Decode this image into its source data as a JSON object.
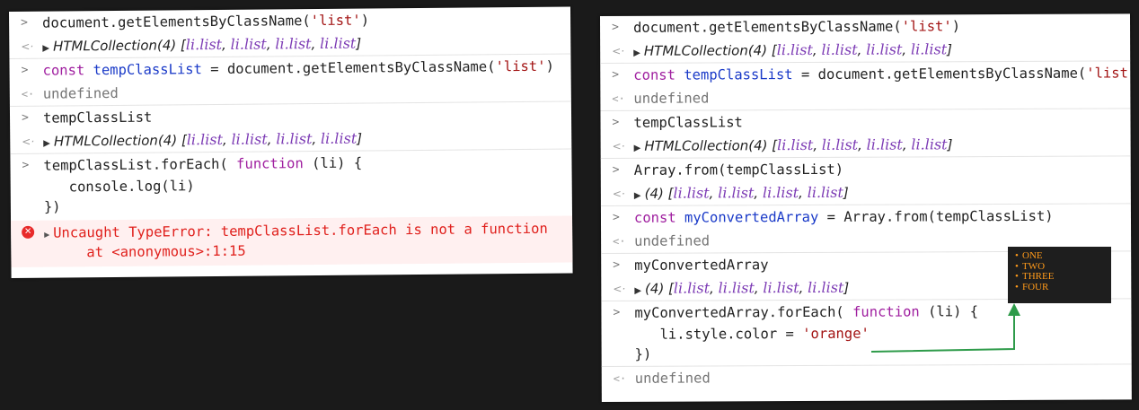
{
  "left_console": {
    "entries": [
      {
        "input": [
          "document.getElementsByClassName(",
          "'list'",
          ")"
        ],
        "result_prefix": "HTMLCollection(4) [",
        "result_items": [
          "li.list",
          "li.list",
          "li.list",
          "li.list"
        ],
        "result_suffix": "]"
      },
      {
        "input_kw": "const",
        "input_var": "tempClassList",
        "input_rest": " = document.getElementsByClassName(",
        "input_str": "'list'",
        "input_end": ")",
        "result": "undefined"
      },
      {
        "input": "tempClassList",
        "result_prefix": "HTMLCollection(4) [",
        "result_items": [
          "li.list",
          "li.list",
          "li.list",
          "li.list"
        ],
        "result_suffix": "]"
      },
      {
        "line1_a": "tempClassList.forEach( ",
        "line1_kw": "function",
        "line1_b": " (li) {",
        "line2": "console.log(li)",
        "line3": "})",
        "error_line1": "Uncaught TypeError: tempClassList.forEach is not a function",
        "error_line2": "at <anonymous>:1:15"
      }
    ]
  },
  "right_console": {
    "entries": [
      {
        "input_a": "document.getElementsByClassName(",
        "input_str": "'list'",
        "input_b": ")",
        "result_prefix": "HTMLCollection(4) [",
        "result_items": [
          "li.list",
          "li.list",
          "li.list",
          "li.list"
        ],
        "result_suffix": "]"
      },
      {
        "input_kw": "const",
        "input_var": "tempClassList",
        "input_rest": " = document.getElementsByClassName(",
        "input_str": "'list'",
        "input_end": ")",
        "result": "undefined"
      },
      {
        "input": "tempClassList",
        "result_prefix": "HTMLCollection(4) [",
        "result_items": [
          "li.list",
          "li.list",
          "li.list",
          "li.list"
        ],
        "result_suffix": "]"
      },
      {
        "input": "Array.from(tempClassList)",
        "result_prefix": "(4) [",
        "result_items": [
          "li.list",
          "li.list",
          "li.list",
          "li.list"
        ],
        "result_suffix": "]"
      },
      {
        "input_kw": "const",
        "input_var": "myConvertedArray",
        "input_rest": " = Array.from(tempClassList)",
        "result": "undefined"
      },
      {
        "input": "myConvertedArray",
        "result_prefix": "(4) [",
        "result_items": [
          "li.list",
          "li.list",
          "li.list",
          "li.list"
        ],
        "result_suffix": "]"
      },
      {
        "line1_a": "myConvertedArray.forEach( ",
        "line1_kw": "function",
        "line1_b": " (li) {",
        "line2_a": "li.style.color = ",
        "line2_str": "'orange'",
        "line3": "})",
        "result": "undefined"
      }
    ]
  },
  "preview_list": [
    "ONE",
    "TWO",
    "THREE",
    "FOUR"
  ],
  "colors": {
    "preview_text": "#ff9a1a",
    "arrow": "#2e9b4a",
    "error": "#e0201c"
  },
  "icons": {
    "prompt": "chevron-right-icon",
    "result": "result-arrow-icon",
    "expand": "expand-triangle-icon",
    "error": "error-icon"
  }
}
